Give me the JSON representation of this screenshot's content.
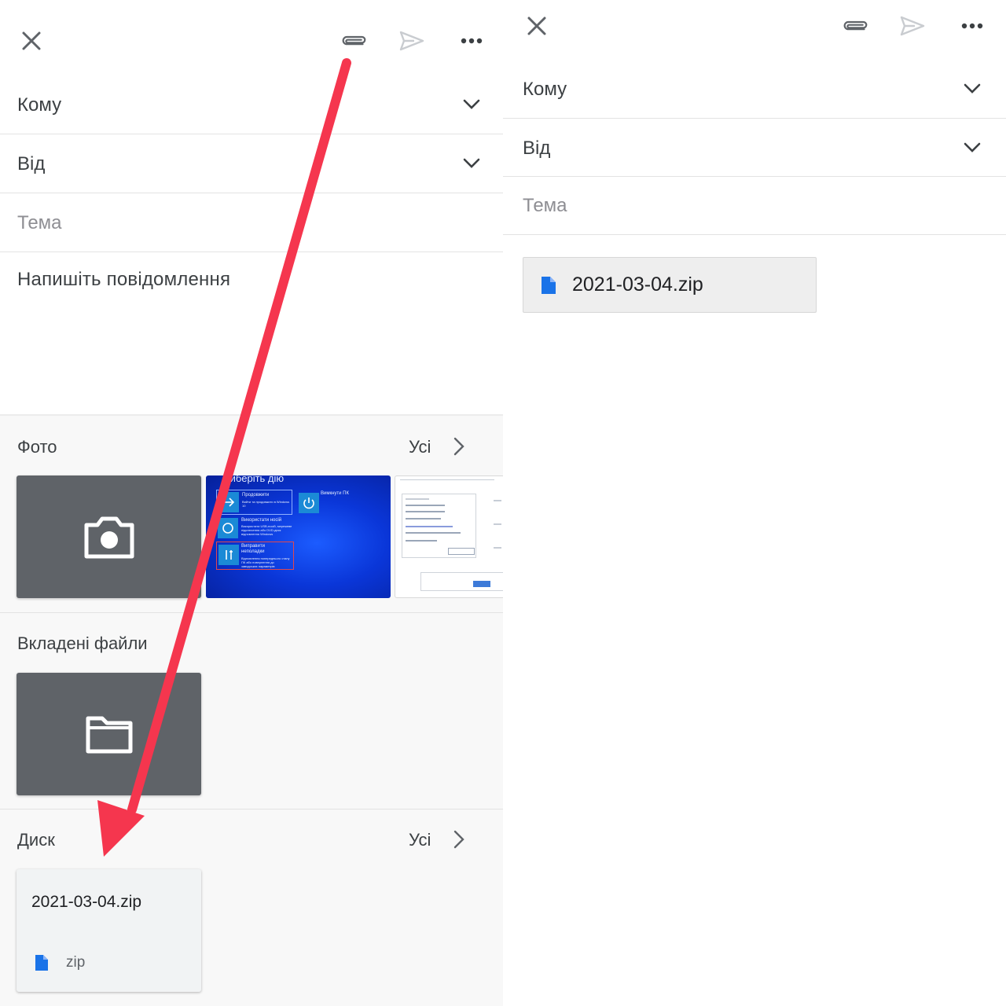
{
  "left": {
    "to_label": "Кому",
    "from_label": "Від",
    "subject_placeholder": "Тема",
    "body_placeholder": "Напишіть повідомлення",
    "photos": {
      "title": "Фото",
      "see_all": "Усі"
    },
    "windows_thumb": {
      "title": "Виберіть дію",
      "option_continue": "Продовжити",
      "option_continue_sub": "Вийти та продовжити в Windows 10",
      "option_use_device": "Використати носій",
      "option_use_device_sub": "Використати USB-носій, мережеве підключення або DVD-диск відновлення Windows",
      "option_troubleshoot": "Виправити неполадки",
      "option_troubleshoot_sub": "Відновлення попереднього стану ПК або повернення до заводських параметрів",
      "option_shutdown": "Вимкнути ПК"
    },
    "attachments": {
      "title": "Вкладені файли"
    },
    "drive": {
      "title": "Диск",
      "see_all": "Усі",
      "file_name": "2021-03-04.zip",
      "file_ext": "zip"
    }
  },
  "right": {
    "to_label": "Кому",
    "from_label": "Від",
    "subject_placeholder": "Тема",
    "attachment_name": "2021-03-04.zip"
  },
  "colors": {
    "arrow": "#f5364e",
    "file_icon": "#1a73e8",
    "tile_dark": "#5f6368",
    "tray": "#f8f8f8"
  }
}
